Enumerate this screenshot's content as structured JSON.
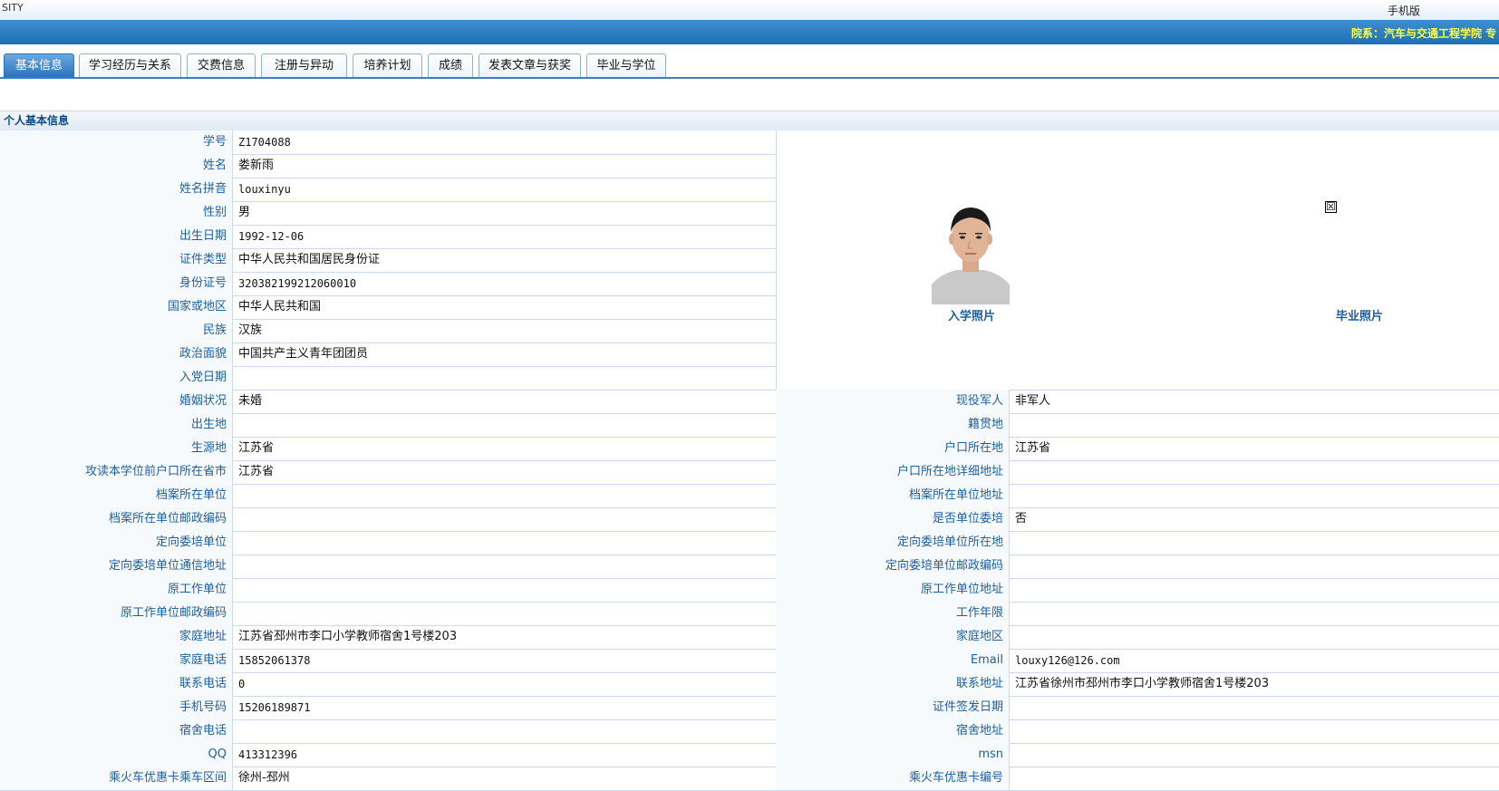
{
  "header": {
    "brand_fragment": "SITY",
    "mobile_link": "手机版",
    "department": "院系：汽车与交通工程学院    专"
  },
  "tabs": [
    "基本信息",
    "学习经历与关系",
    "交费信息",
    "注册与异动",
    "培养计划",
    "成绩",
    "发表文章与获奖",
    "毕业与学位"
  ],
  "active_tab": 0,
  "section_title": "个人基本信息",
  "photo": {
    "enroll_caption": "入学照片",
    "graduate_caption": "毕业照片",
    "broken_symbol": "☒"
  },
  "left_rows": [
    {
      "label": "学号",
      "value": "Z1704088"
    },
    {
      "label": "姓名",
      "value": "娄新雨"
    },
    {
      "label": "姓名拼音",
      "value": "louxinyu"
    },
    {
      "label": "性别",
      "value": "男"
    },
    {
      "label": "出生日期",
      "value": "1992-12-06"
    },
    {
      "label": "证件类型",
      "value": "中华人民共和国居民身份证"
    },
    {
      "label": "身份证号",
      "value": "320382199212060010"
    },
    {
      "label": "国家或地区",
      "value": "中华人民共和国"
    },
    {
      "label": "民族",
      "value": "汉族"
    },
    {
      "label": "政治面貌",
      "value": "中国共产主义青年团团员"
    },
    {
      "label": "入党日期",
      "value": ""
    }
  ],
  "pair_rows": [
    {
      "l_label": "婚姻状况",
      "l_value": "未婚",
      "r_label": "现役军人",
      "r_value": "非军人"
    },
    {
      "l_label": "出生地",
      "l_value": "",
      "r_label": "籍贯地",
      "r_value": ""
    },
    {
      "l_label": "生源地",
      "l_value": "江苏省",
      "r_label": "户口所在地",
      "r_value": "江苏省"
    },
    {
      "l_label": "攻读本学位前户口所在省市",
      "l_value": "江苏省",
      "r_label": "户口所在地详细地址",
      "r_value": ""
    },
    {
      "l_label": "档案所在单位",
      "l_value": "",
      "r_label": "档案所在单位地址",
      "r_value": ""
    },
    {
      "l_label": "档案所在单位邮政编码",
      "l_value": "",
      "r_label": "是否单位委培",
      "r_value": "否"
    },
    {
      "l_label": "定向委培单位",
      "l_value": "",
      "r_label": "定向委培单位所在地",
      "r_value": ""
    },
    {
      "l_label": "定向委培单位通信地址",
      "l_value": "",
      "r_label": "定向委培单位邮政编码",
      "r_value": ""
    },
    {
      "l_label": "原工作单位",
      "l_value": "",
      "r_label": "原工作单位地址",
      "r_value": ""
    },
    {
      "l_label": "原工作单位邮政编码",
      "l_value": "",
      "r_label": "工作年限",
      "r_value": ""
    },
    {
      "l_label": "家庭地址",
      "l_value": "江苏省邳州市李口小学教师宿舍1号楼203",
      "r_label": "家庭地区",
      "r_value": ""
    },
    {
      "l_label": "家庭电话",
      "l_value": "15852061378",
      "r_label": "Email",
      "r_value": "louxy126@126.com"
    },
    {
      "l_label": "联系电话",
      "l_value": "0",
      "r_label": "联系地址",
      "r_value": "江苏省徐州市邳州市李口小学教师宿舍1号楼203"
    },
    {
      "l_label": "手机号码",
      "l_value": "15206189871",
      "r_label": "证件签发日期",
      "r_value": ""
    },
    {
      "l_label": "宿舍电话",
      "l_value": "",
      "r_label": "宿舍地址",
      "r_value": ""
    },
    {
      "l_label": "QQ",
      "l_value": "413312396",
      "r_label": "msn",
      "r_value": ""
    },
    {
      "l_label": "乘火车优惠卡乘车区间",
      "l_value": "徐州-邳州",
      "r_label": "乘火车优惠卡编号",
      "r_value": ""
    }
  ]
}
